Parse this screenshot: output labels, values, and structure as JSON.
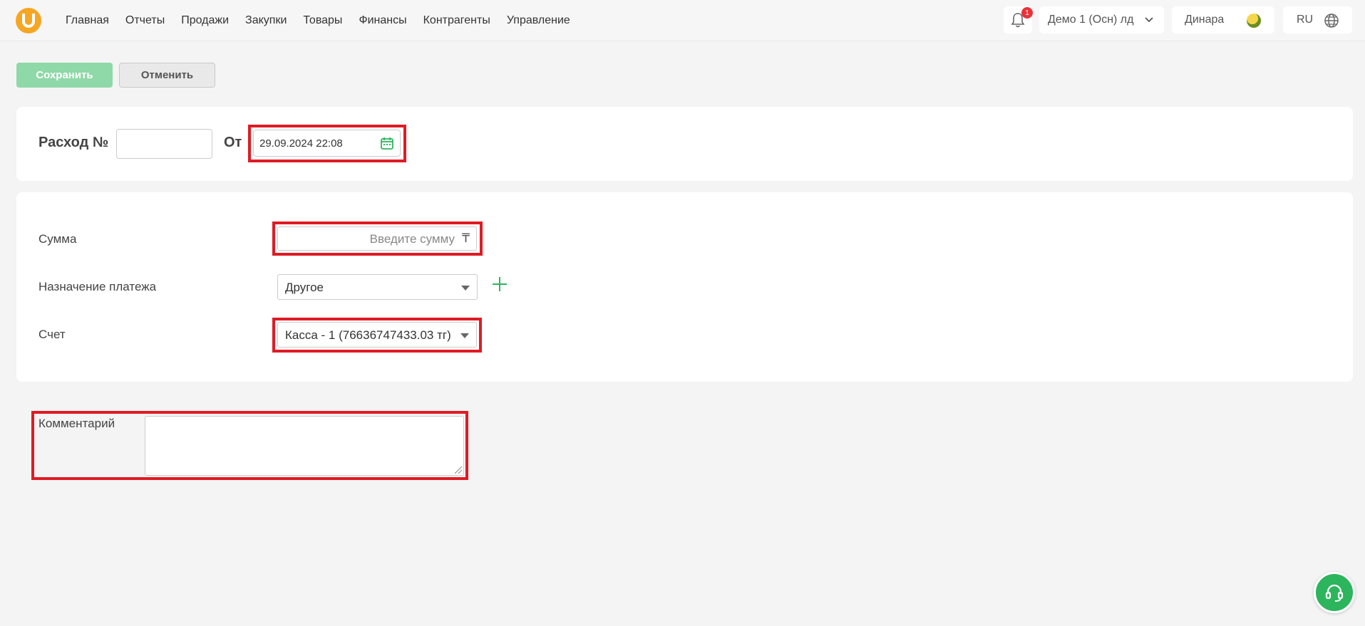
{
  "nav": {
    "items": [
      "Главная",
      "Отчеты",
      "Продажи",
      "Закупки",
      "Товары",
      "Финансы",
      "Контрагенты",
      "Управление"
    ]
  },
  "header": {
    "notifications_count": "1",
    "company": "Демо 1 (Осн) лд",
    "user": "Динара",
    "language": "RU"
  },
  "toolbar": {
    "save_label": "Сохранить",
    "cancel_label": "Отменить"
  },
  "doc": {
    "title_label": "Расход №",
    "number": "",
    "from_label": "От",
    "date": "29.09.2024 22:08"
  },
  "form": {
    "sum_label": "Сумма",
    "sum_placeholder": "Введите сумму",
    "currency_symbol": "₸",
    "purpose_label": "Назначение платежа",
    "purpose_value": "Другое",
    "account_label": "Счет",
    "account_value": "Касса - 1 (76636747433.03 тг)",
    "comment_label": "Комментарий",
    "comment_value": ""
  },
  "colors": {
    "accent": "#2db55d",
    "highlight": "#e01b24",
    "logo": "#f6a623"
  }
}
